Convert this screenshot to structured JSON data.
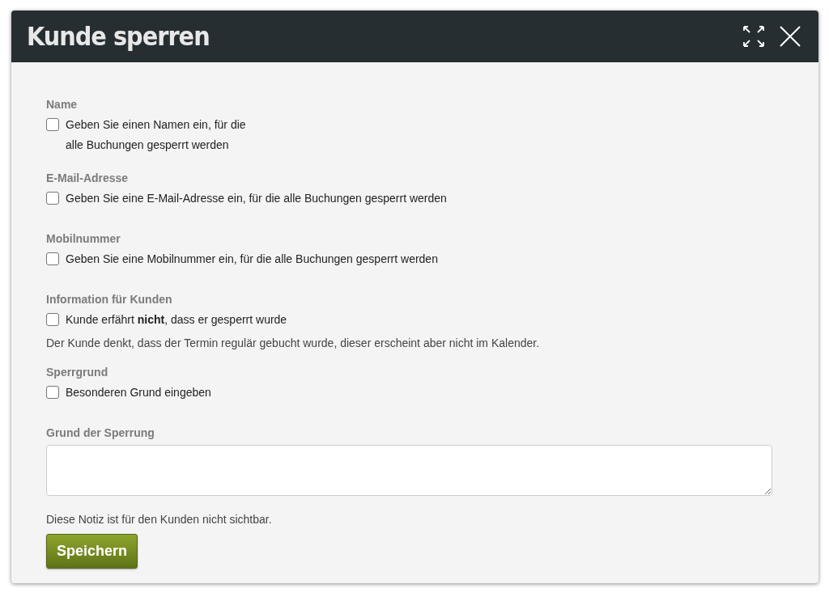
{
  "dialog": {
    "title": "Kunde sperren"
  },
  "options": [
    {
      "label": "Name",
      "text_lines": [
        "Geben Sie einen Namen ein, für die",
        "alle Buchungen gesperrt werden"
      ],
      "checked": false
    },
    {
      "label": "E-Mail-Adresse",
      "text_lines": [
        "Geben Sie eine E-Mail-Adresse ein, für die alle Buchungen gesperrt werden"
      ],
      "checked": false
    },
    {
      "label": "Mobilnummer",
      "text_lines": [
        "Geben Sie eine Mobilnummer ein, für die alle Buchungen gesperrt werden"
      ],
      "checked": false
    },
    {
      "label": "Information für Kunden",
      "text_lines": [
        "Kunde erfährt **nicht**, dass er gesperrt wurde"
      ],
      "checked": false,
      "hint": "Der Kunde denkt, dass der Termin regulär gebucht wurde, dieser erscheint aber nicht im Kalender."
    },
    {
      "label": "Sperrgrund",
      "text_lines": [
        "Besonderen Grund eingeben"
      ],
      "checked": false
    }
  ],
  "reason": {
    "label": "Grund der Sperrung",
    "note": "Diese Notiz ist für den Kunden nicht sichtbar."
  },
  "buttons": [
    "Speichern"
  ]
}
